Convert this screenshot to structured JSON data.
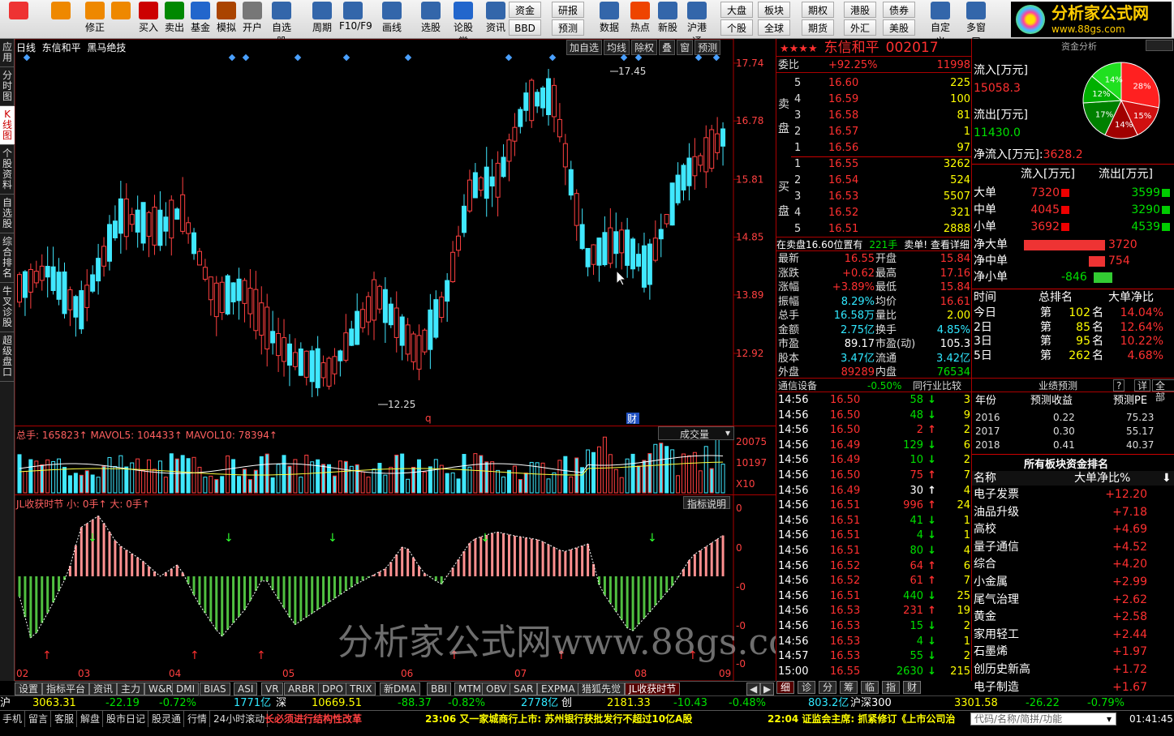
{
  "toolbar": {
    "items": [
      {
        "label": "",
        "icon": "windows-icon"
      },
      {
        "label": "",
        "icon": "back-arrow-icon"
      },
      {
        "label": "修正",
        "icon": "sync-icon"
      },
      {
        "label": "",
        "icon": "refresh-icon"
      },
      {
        "label": "买入",
        "icon": "buy-icon"
      },
      {
        "label": "卖出",
        "icon": "sell-icon"
      },
      {
        "label": "基金",
        "icon": "fund-icon"
      },
      {
        "label": "模拟",
        "icon": "hammer-icon"
      },
      {
        "label": "开户",
        "icon": "lock-icon"
      },
      {
        "label": "自选股",
        "icon": "star-icon"
      },
      {
        "label": "周期",
        "icon": "clock-icon"
      },
      {
        "label": "F10/F9",
        "icon": "f10-icon"
      },
      {
        "label": "画线",
        "icon": "pen-icon"
      },
      {
        "label": "选股",
        "icon": "screen-icon"
      },
      {
        "label": "论股堂",
        "icon": "forum-icon"
      },
      {
        "label": "资讯",
        "icon": "news-icon"
      },
      {
        "label": "数据",
        "icon": "pe-icon"
      },
      {
        "label": "热点",
        "icon": "fire-icon"
      },
      {
        "label": "新股",
        "icon": "new-icon"
      },
      {
        "label": "沪港通",
        "icon": "hk-icon"
      },
      {
        "label": "自定义",
        "icon": "custom-icon"
      },
      {
        "label": "多窗口",
        "icon": "windows-multi-icon"
      }
    ],
    "small": [
      "资金",
      "研报",
      "BBD",
      "预测",
      "大盘",
      "板块",
      "期权",
      "港股",
      "债券",
      "个股",
      "全球",
      "期货",
      "外汇",
      "美股"
    ]
  },
  "logo": {
    "title": "分析家公式网",
    "url": "www.88gs.com"
  },
  "left_tabs": [
    "应用",
    "分时图",
    "K线图",
    "个股资料",
    "自选股",
    "综合排名",
    "牛叉诊股",
    "超级盘口"
  ],
  "chart": {
    "title": "日线",
    "stock": "东信和平",
    "indicator_name": "黑马绝技",
    "buttons": [
      "加自选",
      "均线",
      "除权",
      "叠",
      "窗",
      "预测"
    ],
    "price_ticks": [
      "17.74",
      "16.78",
      "15.81",
      "14.85",
      "13.89",
      "12.92"
    ],
    "high_label": "17.45",
    "low_label": "12.25",
    "vol_header": "总手: 165823↑  MAVOL5: 104433↑  MAVOL10: 78394↑",
    "vol_select": "成交量",
    "vol_ticks": [
      "20075",
      "10197",
      "X10"
    ],
    "jl_header": "JL收获时节 小: 0手↑ 大: 0手↑",
    "jl_button": "指标说明",
    "jl_ticks": [
      "0",
      "0",
      "-0",
      "-0",
      "-0",
      "-0"
    ],
    "months": [
      "02",
      "03",
      "04",
      "05",
      "06",
      "07",
      "08",
      "09"
    ],
    "markers": [
      "q",
      "财"
    ],
    "watermark": "分析家公式网www.88gs.com"
  },
  "bottom_tabs": [
    "设置",
    "指标平台",
    "资讯",
    "主力",
    "W&R",
    "DMI",
    "BIAS",
    "ASI",
    "VR",
    "ARBR",
    "DPO",
    "TRIX",
    "新DMA",
    "BBI",
    "MTM",
    "OBV",
    "SAR",
    "EXPMA",
    "猎狐先觉",
    "JL收获时节"
  ],
  "quote": {
    "stars": "★★★★",
    "name": "东信和平",
    "code": "002017",
    "weibi_label": "委比",
    "weibi": "+92.25%",
    "weicha": "11998",
    "sell": [
      [
        "5",
        "16.60",
        "225"
      ],
      [
        "4",
        "16.59",
        "100"
      ],
      [
        "3",
        "16.58",
        "81"
      ],
      [
        "2",
        "16.57",
        "1"
      ],
      [
        "1",
        "16.56",
        "97"
      ]
    ],
    "buy": [
      [
        "1",
        "16.55",
        "3262"
      ],
      [
        "2",
        "16.54",
        "524"
      ],
      [
        "3",
        "16.53",
        "5507"
      ],
      [
        "4",
        "16.52",
        "321"
      ],
      [
        "5",
        "16.51",
        "2888"
      ]
    ],
    "sell_label": "卖盘",
    "buy_label": "买盘",
    "notice": "在卖盘16.60位置有",
    "notice_vol": "221手",
    "notice_end": "卖单! 查看详细",
    "stats": [
      [
        "最新",
        "16.55",
        "开盘",
        "15.84"
      ],
      [
        "涨跌",
        "+0.62",
        "最高",
        "17.16"
      ],
      [
        "涨幅",
        "+3.89%",
        "最低",
        "15.84"
      ],
      [
        "振幅",
        "8.29%",
        "均价",
        "16.61"
      ],
      [
        "总手",
        "16.58万",
        "量比",
        "2.00"
      ],
      [
        "金额",
        "2.75亿",
        "换手",
        "4.85%"
      ],
      [
        "市盈",
        "89.17",
        "市盈(动)",
        "105.3"
      ],
      [
        "股本",
        "3.47亿",
        "流通",
        "3.42亿"
      ],
      [
        "外盘",
        "89289",
        "内盘",
        "76534"
      ]
    ],
    "tick_header": [
      "通信设备",
      "-0.50%",
      "同行业比较"
    ],
    "ticks": [
      [
        "14:56",
        "16.50",
        "58",
        "d",
        "3"
      ],
      [
        "14:56",
        "16.50",
        "48",
        "d",
        "9"
      ],
      [
        "14:56",
        "16.50",
        "2",
        "u",
        "2"
      ],
      [
        "14:56",
        "16.49",
        "129",
        "d",
        "6"
      ],
      [
        "14:56",
        "16.49",
        "10",
        "d",
        "2"
      ],
      [
        "14:56",
        "16.50",
        "75",
        "u",
        "7"
      ],
      [
        "14:56",
        "16.49",
        "30",
        "u",
        "4"
      ],
      [
        "14:56",
        "16.51",
        "996",
        "u",
        "24"
      ],
      [
        "14:56",
        "16.51",
        "41",
        "d",
        "1"
      ],
      [
        "14:56",
        "16.51",
        "4",
        "d",
        "1"
      ],
      [
        "14:56",
        "16.51",
        "80",
        "d",
        "4"
      ],
      [
        "14:56",
        "16.52",
        "64",
        "u",
        "6"
      ],
      [
        "14:56",
        "16.52",
        "61",
        "u",
        "7"
      ],
      [
        "14:56",
        "16.51",
        "440",
        "d",
        "25"
      ],
      [
        "14:56",
        "16.53",
        "231",
        "u",
        "19"
      ],
      [
        "14:56",
        "16.53",
        "15",
        "d",
        "2"
      ],
      [
        "14:56",
        "16.53",
        "4",
        "d",
        "1"
      ],
      [
        "14:57",
        "16.53",
        "55",
        "d",
        "2"
      ],
      [
        "15:00",
        "16.55",
        "2630",
        "d",
        "215"
      ]
    ],
    "tick_tabs": [
      "细",
      "诊",
      "分",
      "筹",
      "临",
      "指",
      "财"
    ]
  },
  "funds": {
    "title": "资金分析",
    "inflow_label": "流入[万元]",
    "inflow": "15058.3",
    "outflow_label": "流出[万元]",
    "outflow": "11430.0",
    "net_label": "净流入[万元]:",
    "net": "3628.2",
    "pie": [
      {
        "label": "28%",
        "value": 28,
        "color": "#ff2020"
      },
      {
        "label": "15%",
        "value": 15,
        "color": "#d01010"
      },
      {
        "label": "14%",
        "value": 14,
        "color": "#a00000"
      },
      {
        "label": "17%",
        "value": 17,
        "color": "#008000"
      },
      {
        "label": "12%",
        "value": 12,
        "color": "#00b000"
      },
      {
        "label": "14%",
        "value": 14,
        "color": "#20e020"
      }
    ],
    "table_head": [
      "流入[万元]",
      "流出[万元]"
    ],
    "table": [
      [
        "大单",
        "7320",
        "3599"
      ],
      [
        "中单",
        "4045",
        "3290"
      ],
      [
        "小单",
        "3692",
        "4539"
      ]
    ],
    "net_rows": [
      [
        "净大单",
        "3720",
        1.0
      ],
      [
        "净中单",
        "754",
        0.2
      ],
      [
        "净小单",
        "-846",
        0.23
      ]
    ],
    "rank_head": [
      "时间",
      "总排名",
      "大单净比"
    ],
    "ranks": [
      [
        "今日",
        "第",
        "102",
        "名",
        "14.04%"
      ],
      [
        "2日",
        "第",
        "85",
        "名",
        "12.64%"
      ],
      [
        "3日",
        "第",
        "95",
        "名",
        "10.22%"
      ],
      [
        "5日",
        "第",
        "262",
        "名",
        "4.68%"
      ]
    ],
    "forecast_title": "业绩预测",
    "forecast_btns": [
      "?",
      "详",
      "全部"
    ],
    "forecast_head": [
      "年份",
      "预测收益",
      "预测PE"
    ],
    "forecast": [
      [
        "2016",
        "0.22",
        "75.23"
      ],
      [
        "2017",
        "0.30",
        "55.17"
      ],
      [
        "2018",
        "0.41",
        "40.37"
      ]
    ],
    "sector_title": "所有板块资金排名",
    "sector_head": [
      "名称",
      "大单净比%"
    ],
    "sectors": [
      [
        "电子发票",
        "+12.20"
      ],
      [
        "油品升级",
        "+7.18"
      ],
      [
        "高校",
        "+4.69"
      ],
      [
        "量子通信",
        "+4.52"
      ],
      [
        "综合",
        "+4.20"
      ],
      [
        "小金属",
        "+2.99"
      ],
      [
        "尾气治理",
        "+2.62"
      ],
      [
        "黄金",
        "+2.58"
      ],
      [
        "家用轻工",
        "+2.44"
      ],
      [
        "石墨烯",
        "+1.97"
      ],
      [
        "创历史新高",
        "+1.72"
      ],
      [
        "电子制造",
        "+1.67"
      ]
    ]
  },
  "indexbar": {
    "sh": [
      "沪",
      "3063.31",
      "-22.19",
      "-0.72%",
      "1771亿"
    ],
    "sz": [
      "深",
      "10669.51",
      "-88.37",
      "-0.82%",
      "2778亿"
    ],
    "cy": [
      "创",
      "2181.33",
      "-10.43",
      "-0.48%",
      "803.2亿"
    ],
    "hs": [
      "沪深300",
      "3301.58",
      "-26.22",
      "-0.79%"
    ]
  },
  "statusbar": {
    "items": [
      "手机",
      "留言",
      "客服",
      "解盘",
      "股市日记",
      "股灵通",
      "行情",
      "24小时滚动"
    ],
    "news": [
      "长必须进行结构性改革",
      "23:06 又一家城商行上市: 苏州银行获批发行不超过10亿A股",
      "22:04 证监会主席: 抓紧修订《上市公司治"
    ],
    "search": "代码/名称/简拼/功能",
    "time": "01:41:45"
  }
}
